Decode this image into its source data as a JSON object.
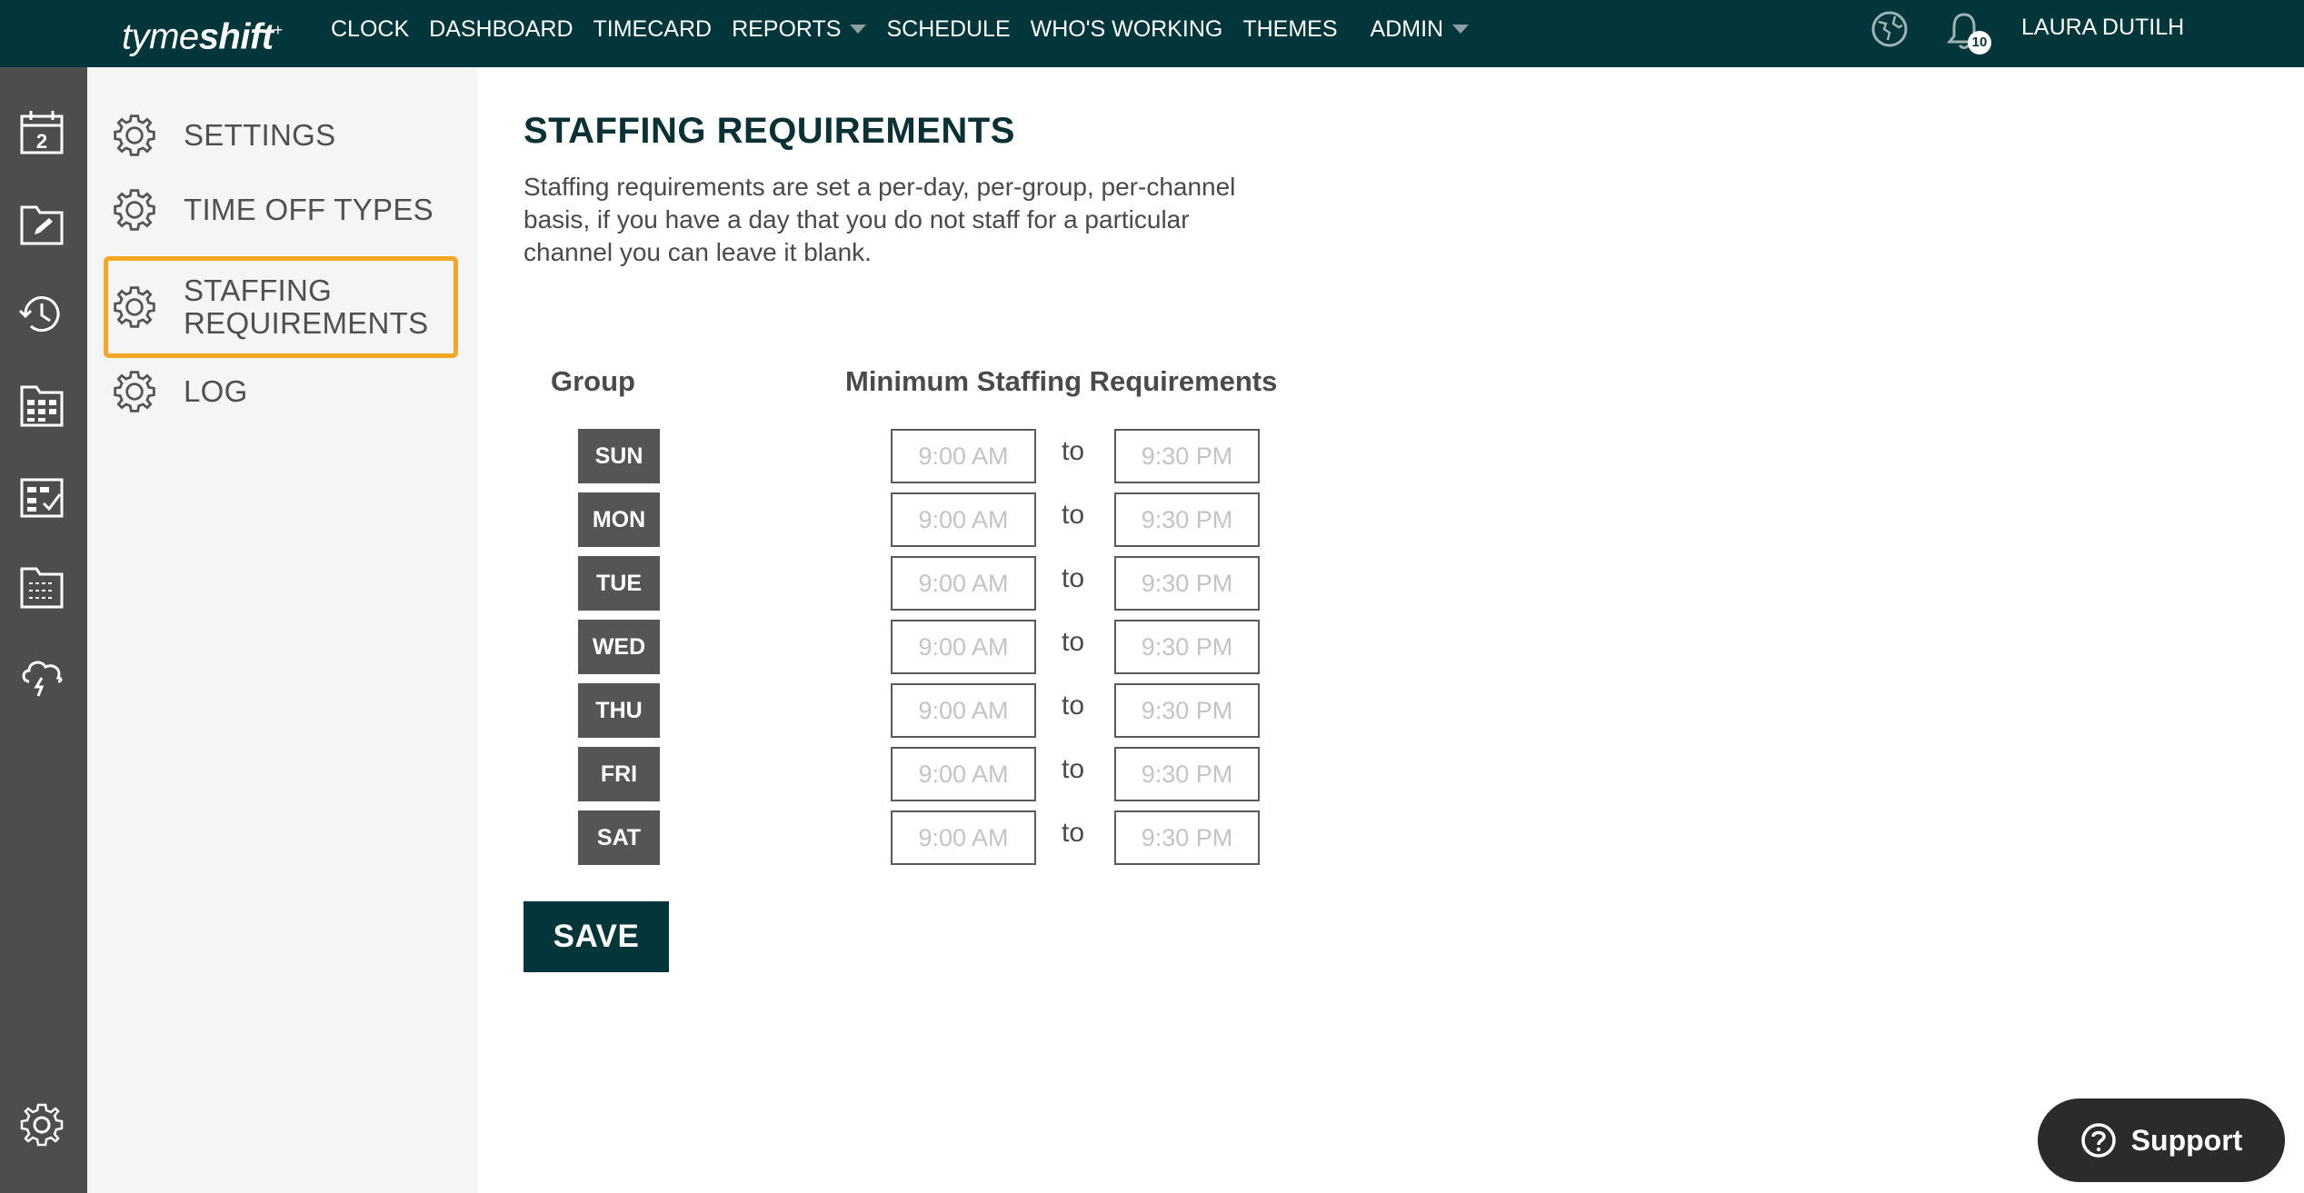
{
  "topbar": {
    "logo_light": "tyme",
    "logo_bold": "shift",
    "logo_mark": "+",
    "nav": [
      {
        "label": "CLOCK",
        "has_dropdown": false
      },
      {
        "label": "DASHBOARD",
        "has_dropdown": false
      },
      {
        "label": "TIMECARD",
        "has_dropdown": false
      },
      {
        "label": "REPORTS",
        "has_dropdown": true
      },
      {
        "label": "SCHEDULE",
        "has_dropdown": false
      },
      {
        "label": "WHO'S WORKING",
        "has_dropdown": false
      },
      {
        "label": "THEMES",
        "has_dropdown": false
      },
      {
        "label": "ADMIN",
        "has_dropdown": true
      }
    ],
    "notification_count": "10",
    "user_name": "LAURA DUTILH"
  },
  "rail": {
    "icons": [
      "calendar-icon",
      "folder-edit-icon",
      "clock-history-icon",
      "schedule-grid-icon",
      "checklist-icon",
      "folder-list-icon",
      "storm-cloud-icon"
    ],
    "bottom_icon": "gear-icon"
  },
  "subnav": {
    "items": [
      {
        "label": "SETTINGS",
        "active": false
      },
      {
        "label": "TIME OFF TYPES",
        "active": false
      },
      {
        "label": "STAFFING REQUIREMENTS",
        "active": true
      },
      {
        "label": "LOG",
        "active": false
      }
    ]
  },
  "main": {
    "title": "STAFFING REQUIREMENTS",
    "description": "Staffing requirements are set a per-day, per-group, per-channel basis, if you have a day that you do not staff for a particular channel you can leave it blank.",
    "group_header": "Group",
    "requirements_header": "Minimum Staffing Requirements",
    "to_label": "to",
    "days": [
      {
        "day": "SUN",
        "start_placeholder": "9:00 AM",
        "end_placeholder": "9:30 PM"
      },
      {
        "day": "MON",
        "start_placeholder": "9:00 AM",
        "end_placeholder": "9:30 PM"
      },
      {
        "day": "TUE",
        "start_placeholder": "9:00 AM",
        "end_placeholder": "9:30 PM"
      },
      {
        "day": "WED",
        "start_placeholder": "9:00 AM",
        "end_placeholder": "9:30 PM"
      },
      {
        "day": "THU",
        "start_placeholder": "9:00 AM",
        "end_placeholder": "9:30 PM"
      },
      {
        "day": "FRI",
        "start_placeholder": "9:00 AM",
        "end_placeholder": "9:30 PM"
      },
      {
        "day": "SAT",
        "start_placeholder": "9:00 AM",
        "end_placeholder": "9:30 PM"
      }
    ],
    "save_label": "SAVE"
  },
  "support": {
    "label": "Support",
    "icon": "question-circle-icon"
  },
  "colors": {
    "topbar": "#03363a",
    "rail": "#4d4d4d",
    "subnav": "#f5f5f5",
    "active_outline": "#f5a623",
    "day_badge": "#555555",
    "save_button": "#03363a",
    "support_button": "#2b2b2b"
  }
}
